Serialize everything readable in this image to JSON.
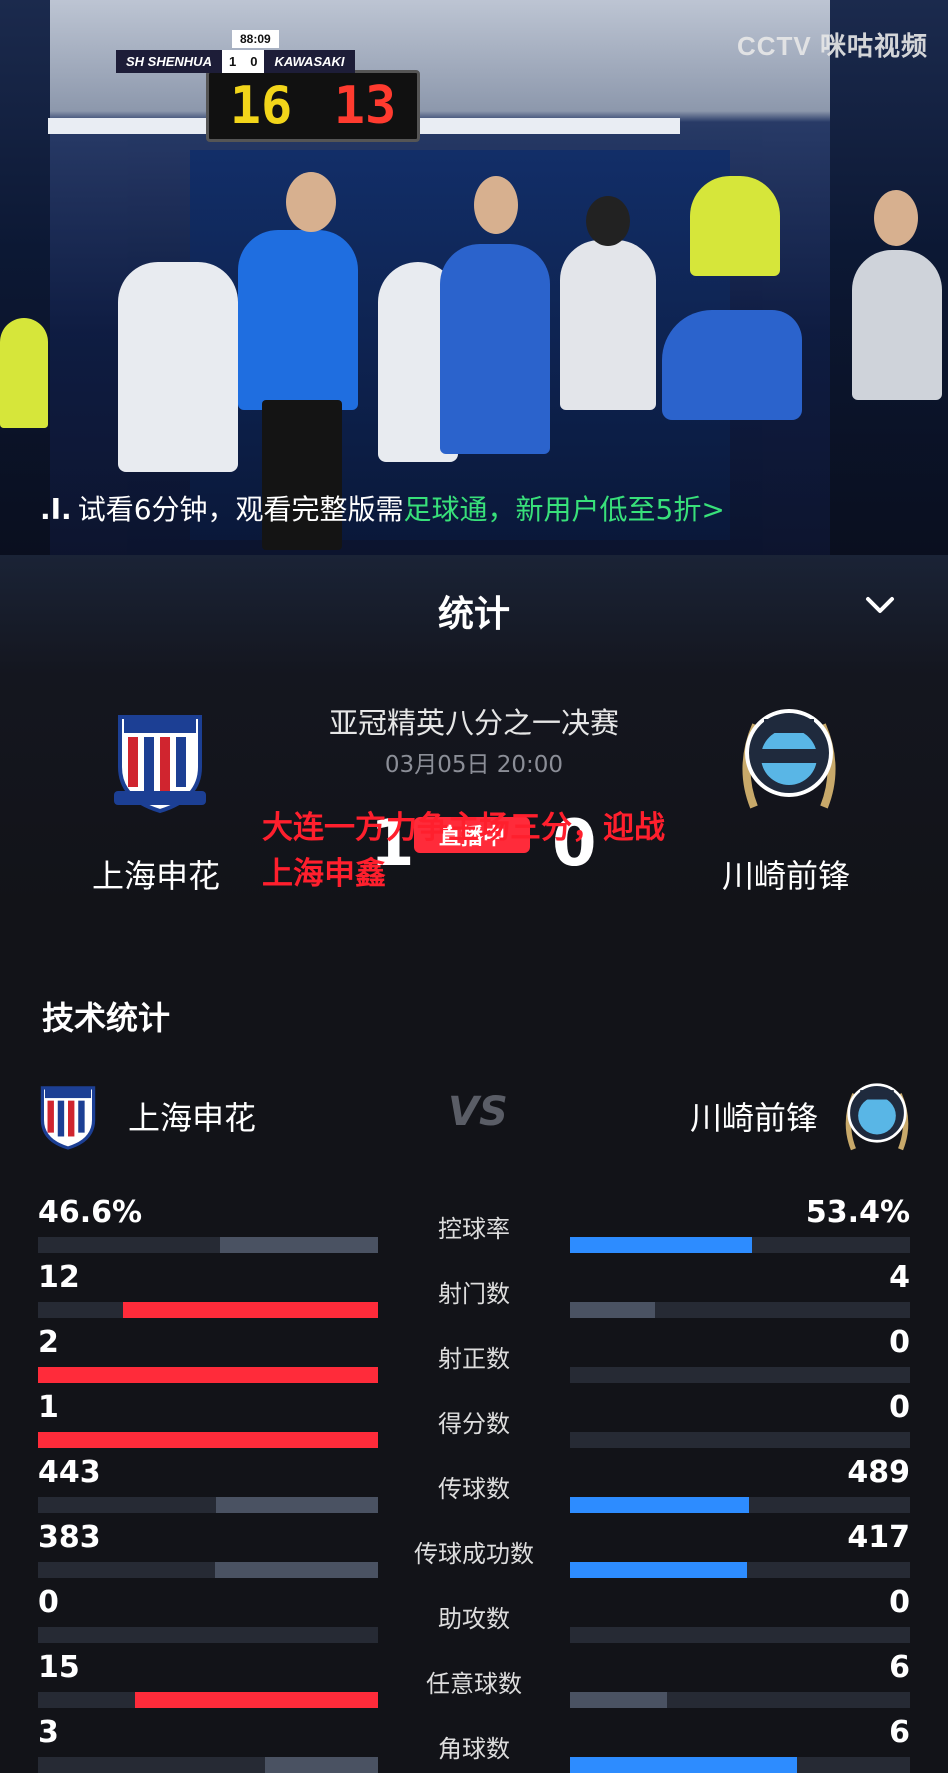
{
  "video": {
    "scorebug": {
      "home": "SH SHENHUA",
      "home_score": "1",
      "away_score": "0",
      "away": "KAWASAKI",
      "clock": "88:09"
    },
    "board": {
      "in": "16",
      "out": "13"
    },
    "broadcaster": "CCTV 咪咕视频",
    "promo": {
      "prefix": "试看6分钟，观看完整版需",
      "highlight": "足球通，新用户低至5折>"
    }
  },
  "panel": {
    "title": "统计",
    "match_name": "亚冠精英八分之一决赛",
    "match_time": "03月05日 20:00",
    "home_team": "上海申花",
    "away_team": "川崎前锋",
    "home_score": "1",
    "away_score": "0",
    "live_tag": "直播中",
    "overlay_headline": "大连一方力争主场三分，迎战上海申鑫",
    "section_title": "技术统计",
    "vs": "VS"
  },
  "colors": {
    "home": "#ff2b3a",
    "away": "#2d8cff",
    "neutral": "#4a5262"
  },
  "stats": [
    {
      "label": "控球率",
      "home": "46.6%",
      "away": "53.4%",
      "home_frac": 0.466,
      "away_frac": 0.534,
      "leader": "away"
    },
    {
      "label": "射门数",
      "home": "12",
      "away": "4",
      "home_frac": 0.75,
      "away_frac": 0.25,
      "leader": "home"
    },
    {
      "label": "射正数",
      "home": "2",
      "away": "0",
      "home_frac": 1.0,
      "away_frac": 0.0,
      "leader": "home"
    },
    {
      "label": "得分数",
      "home": "1",
      "away": "0",
      "home_frac": 1.0,
      "away_frac": 0.0,
      "leader": "home"
    },
    {
      "label": "传球数",
      "home": "443",
      "away": "489",
      "home_frac": 0.475,
      "away_frac": 0.525,
      "leader": "away"
    },
    {
      "label": "传球成功数",
      "home": "383",
      "away": "417",
      "home_frac": 0.479,
      "away_frac": 0.521,
      "leader": "away"
    },
    {
      "label": "助攻数",
      "home": "0",
      "away": "0",
      "home_frac": 0.0,
      "away_frac": 0.0,
      "leader": "none"
    },
    {
      "label": "任意球数",
      "home": "15",
      "away": "6",
      "home_frac": 0.714,
      "away_frac": 0.286,
      "leader": "home"
    },
    {
      "label": "角球数",
      "home": "3",
      "away": "6",
      "home_frac": 0.333,
      "away_frac": 0.667,
      "leader": "away"
    }
  ]
}
